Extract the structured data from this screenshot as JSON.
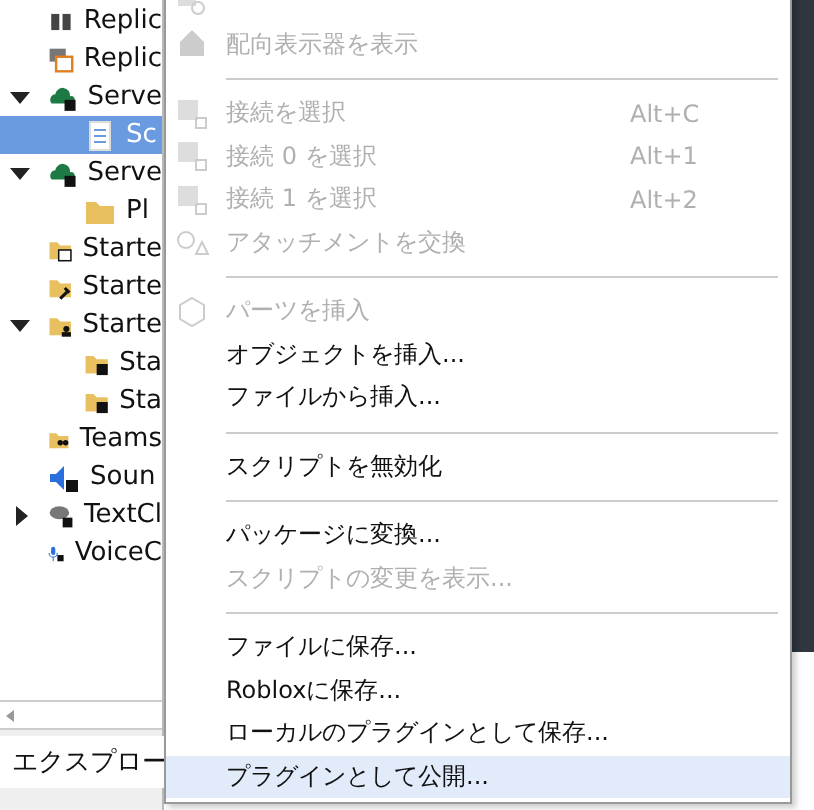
{
  "explorer": {
    "items": [
      {
        "label": "Replic",
        "kind": "storage"
      },
      {
        "label": "Replic",
        "kind": "first"
      },
      {
        "label": "Serve",
        "kind": "cloud",
        "expanded": true,
        "selected": false,
        "children": [
          {
            "label": "Sc",
            "kind": "script",
            "selected": true
          }
        ]
      },
      {
        "label": "Serve",
        "kind": "cloud2",
        "expanded": true,
        "children": [
          {
            "label": "Pl",
            "kind": "folder",
            "selected": false
          }
        ]
      },
      {
        "label": "Starte",
        "kind": "gui"
      },
      {
        "label": "Starte",
        "kind": "tool"
      },
      {
        "label": "Starte",
        "kind": "player",
        "expanded": true,
        "children": [
          {
            "label": "Sta",
            "kind": "scriptfolder",
            "selected": false
          },
          {
            "label": "Sta",
            "kind": "scriptfolder",
            "selected": false
          }
        ]
      },
      {
        "label": "Teams",
        "kind": "teams"
      },
      {
        "label": "Soun",
        "kind": "sound"
      },
      {
        "label": "TextCl",
        "kind": "chat",
        "expanded": false
      },
      {
        "label": "VoiceC",
        "kind": "voice"
      }
    ],
    "tab": "エクスプロー"
  },
  "context_menu": [
    {
      "kind": "item",
      "label": "配向表示器を表示",
      "disabled": true,
      "selected": false
    },
    {
      "kind": "separator"
    },
    {
      "kind": "item",
      "label": "接続を選択",
      "shortcut": "Alt+C",
      "disabled": true,
      "selected": false
    },
    {
      "kind": "item",
      "label": "接続 0 を選択",
      "shortcut": "Alt+1",
      "disabled": true,
      "selected": false
    },
    {
      "kind": "item",
      "label": "接続 1 を選択",
      "shortcut": "Alt+2",
      "disabled": true,
      "selected": false
    },
    {
      "kind": "item",
      "label": "アタッチメントを交換",
      "disabled": true,
      "selected": false
    },
    {
      "kind": "separator"
    },
    {
      "kind": "item",
      "label": "パーツを挿入",
      "disabled": true,
      "selected": false
    },
    {
      "kind": "item",
      "label": "オブジェクトを挿入...",
      "disabled": false,
      "selected": false
    },
    {
      "kind": "item",
      "label": "ファイルから挿入...",
      "disabled": false,
      "selected": false
    },
    {
      "kind": "separator"
    },
    {
      "kind": "item",
      "label": "スクリプトを無効化",
      "disabled": false,
      "selected": false
    },
    {
      "kind": "separator"
    },
    {
      "kind": "item",
      "label": "パッケージに変換...",
      "disabled": false,
      "selected": false
    },
    {
      "kind": "item",
      "label": "スクリプトの変更を表示...",
      "disabled": true,
      "selected": false
    },
    {
      "kind": "separator"
    },
    {
      "kind": "item",
      "label": "ファイルに保存...",
      "disabled": false,
      "selected": false
    },
    {
      "kind": "item",
      "label": "Robloxに保存...",
      "disabled": false,
      "selected": false
    },
    {
      "kind": "item",
      "label": "ローカルのプラグインとして保存...",
      "disabled": false,
      "selected": false
    },
    {
      "kind": "item",
      "label": "プラグインとして公開...",
      "disabled": false,
      "selected": true
    }
  ]
}
